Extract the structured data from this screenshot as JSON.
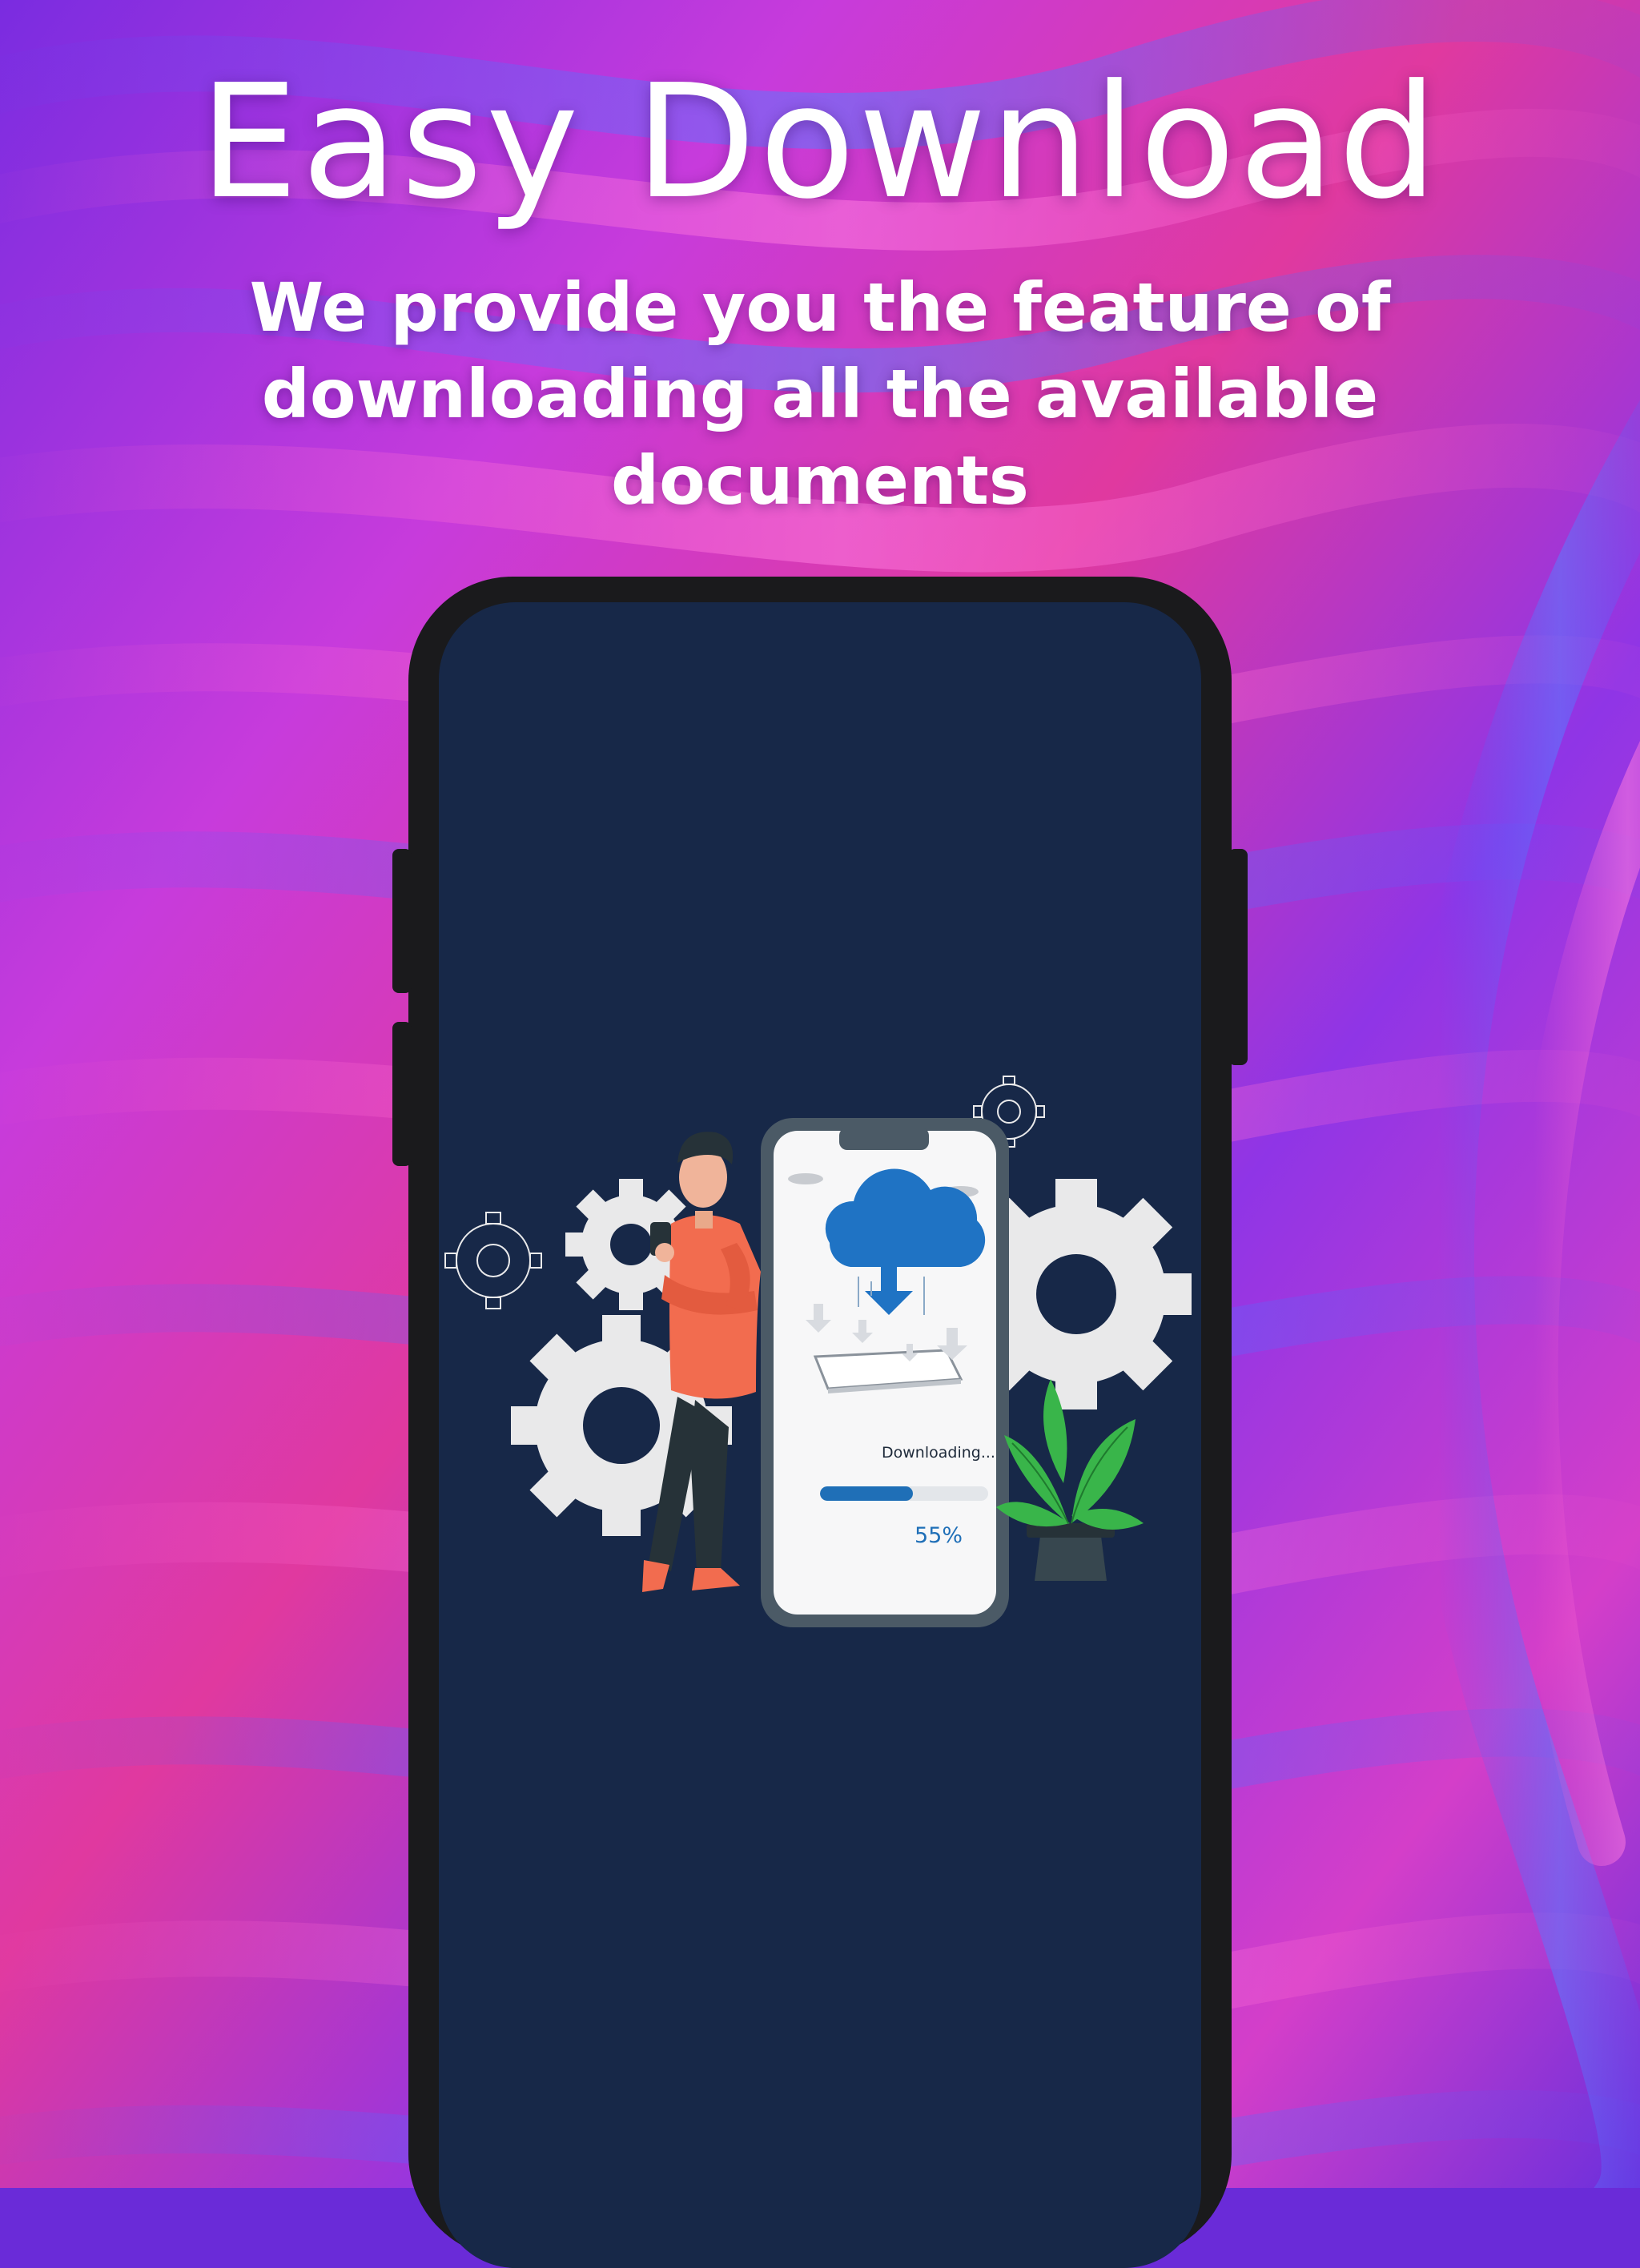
{
  "header": {
    "title": "Easy Download",
    "subtitle": "We provide you the feature of downloading all the available documents"
  },
  "illustration": {
    "status_text": "Downloading...",
    "progress_text": "55%",
    "progress_value": 0.55
  },
  "colors": {
    "screen_background": "#172848",
    "phone_frame": "#1a1a1c",
    "progress_fill": "#1f6fb7",
    "cloud_icon": "#1f73c4",
    "shirt": "#f26c4f",
    "gear": "#e9e9ea",
    "leaf": "#39b54a"
  },
  "icons": [
    "cloud-download-icon",
    "gear-icon",
    "plant-icon",
    "smartphone-icon"
  ]
}
